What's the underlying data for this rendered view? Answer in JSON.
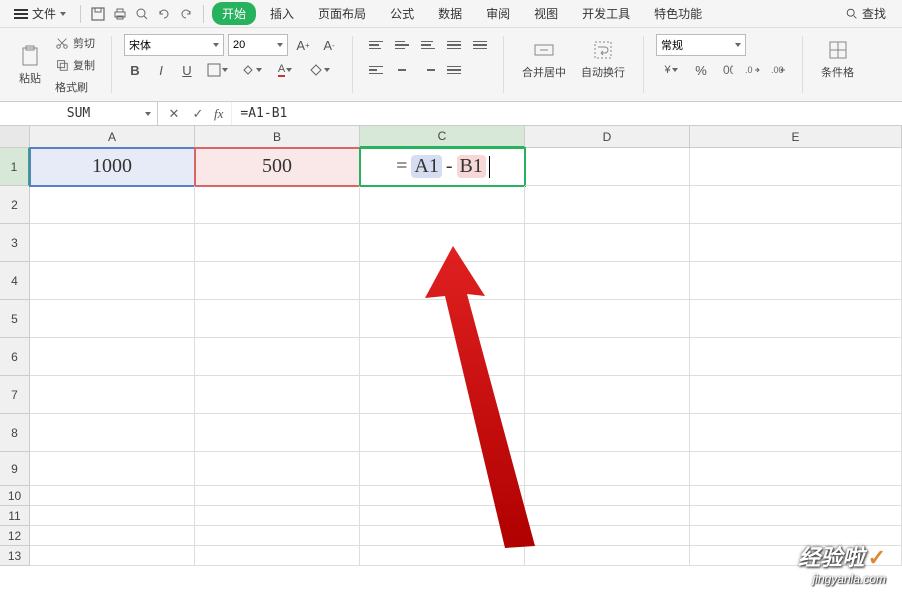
{
  "menu": {
    "file": "文件",
    "home": "开始",
    "tabs": [
      "插入",
      "页面布局",
      "公式",
      "数据",
      "审阅",
      "视图",
      "开发工具",
      "特色功能"
    ],
    "search": "查找"
  },
  "ribbon": {
    "paste": "粘贴",
    "cut": "剪切",
    "copy": "复制",
    "format_painter": "格式刷",
    "font_name": "宋体",
    "font_size": "20",
    "merge": "合并居中",
    "wrap": "自动换行",
    "number_format": "常规",
    "cond_format": "条件格"
  },
  "formula_bar": {
    "name_box": "SUM",
    "formula": "=A1-B1"
  },
  "columns": [
    "A",
    "B",
    "C",
    "D",
    "E"
  ],
  "rows": [
    "1",
    "2",
    "3",
    "4",
    "5",
    "6",
    "7",
    "8",
    "9",
    "10",
    "11",
    "12",
    "13"
  ],
  "cells": {
    "A1": "1000",
    "B1": "500",
    "C1_tokens": {
      "eq": "=",
      "a": "A1",
      "op": "-",
      "b": "B1"
    }
  },
  "watermark": {
    "title": "经验啦",
    "check": "✓",
    "sub": "jingyanla.com"
  },
  "chart_data": {
    "type": "table",
    "columns": [
      "A",
      "B",
      "C"
    ],
    "rows": [
      {
        "A": 1000,
        "B": 500,
        "C": "=A1-B1"
      }
    ]
  }
}
